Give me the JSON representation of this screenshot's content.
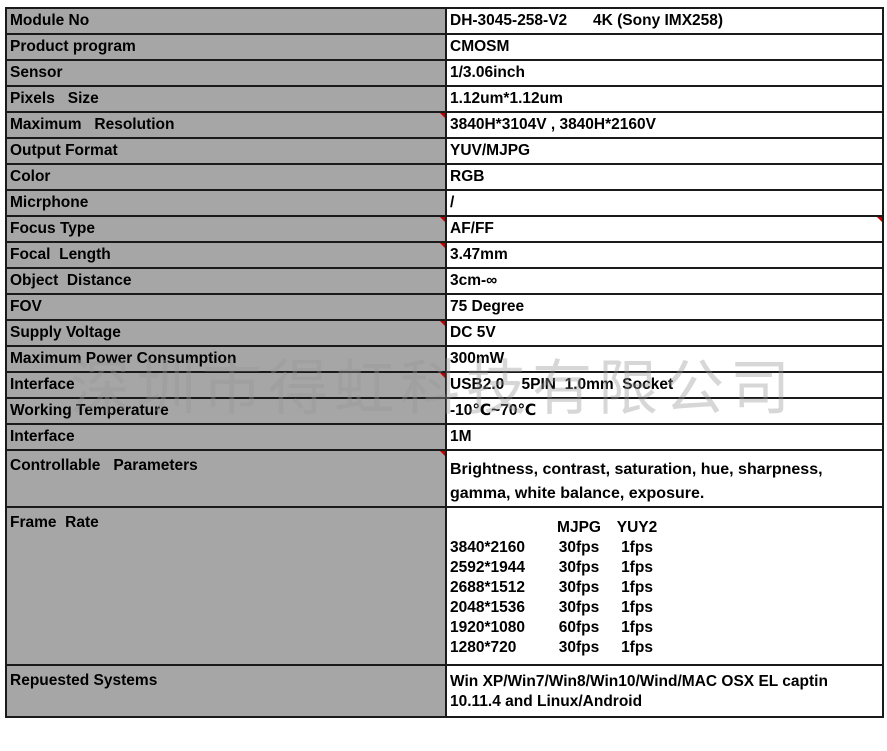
{
  "rows": [
    {
      "key": "Module No",
      "value": "DH-3045-258-V2      4K (Sony IMX258)"
    },
    {
      "key": "Product program",
      "value": "CMOSM"
    },
    {
      "key": "Sensor",
      "value": "1/3.06inch"
    },
    {
      "key": "Pixels   Size",
      "value": "1.12um*1.12um"
    },
    {
      "key": "Maximum   Resolution",
      "value": "3840H*3104V , 3840H*2160V"
    },
    {
      "key": "Output Format",
      "value": "YUV/MJPG"
    },
    {
      "key": "Color",
      "value": "RGB"
    },
    {
      "key": "Micrphone",
      "value": "/"
    },
    {
      "key": "Focus Type",
      "value": "AF/FF"
    },
    {
      "key": "Focal  Length",
      "value": "3.47mm"
    },
    {
      "key": "Object  Distance",
      "value": "3cm-∞"
    },
    {
      "key": "FOV",
      "value": "75 Degree"
    },
    {
      "key": "Supply Voltage",
      "value": "DC 5V"
    },
    {
      "key": "Maximum Power Consumption",
      "value": "300mW"
    },
    {
      "key": "Interface",
      "value": "USB2.0    5PIN  1.0mm  Socket"
    },
    {
      "key": "Working Temperature",
      "value": "-10℃~70℃"
    },
    {
      "key": "Interface",
      "value": "1M"
    }
  ],
  "controllable": {
    "key": "Controllable   Parameters",
    "line1": "Brightness, contrast, saturation, hue, sharpness,",
    "line2": "gamma, white balance, exposure."
  },
  "frame_rate": {
    "key": "Frame  Rate",
    "header": [
      "",
      "MJPG",
      "YUY2"
    ],
    "rows": [
      [
        "3840*2160",
        "30fps",
        "1fps"
      ],
      [
        "2592*1944",
        "30fps",
        "1fps"
      ],
      [
        "2688*1512",
        "30fps",
        "1fps"
      ],
      [
        "2048*1536",
        "30fps",
        "1fps"
      ],
      [
        "1920*1080",
        "60fps",
        "1fps"
      ],
      [
        "1280*720",
        "30fps",
        "1fps"
      ]
    ]
  },
  "requested": {
    "key": "Repuested Systems",
    "line1": "Win XP/Win7/Win8/Win10/Wind/MAC OSX EL captin",
    "line2": "10.11.4 and Linux/Android"
  },
  "watermark": "深圳市得虹科技有限公司",
  "colors": {
    "key_cell_bg": "#a6a6a6",
    "value_cell_bg": "#ffffff",
    "border": "#1a1a1a",
    "comment_marker": "#c00000"
  }
}
